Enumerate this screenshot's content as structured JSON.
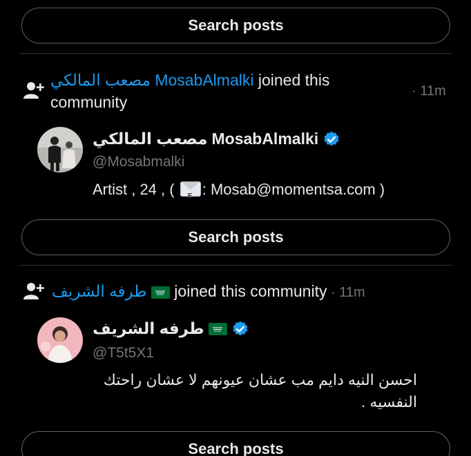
{
  "search_label": "Search posts",
  "events": [
    {
      "user_link_arabic": "مصعب المالكي",
      "user_link_latin": "MosabAlmalki",
      "action": " joined this",
      "action_line2": "community",
      "time": "· 11m",
      "display_name_arabic": "مصعب المالكي",
      "display_name_latin": "MosabAlmalki",
      "handle": "@Mosabmalki",
      "bio_before": "Artist , 24 , (",
      "bio_after": ": Mosab@momentsa.com )"
    },
    {
      "user_link_arabic": "طرفه الشريف",
      "action": " joined this community",
      "time": " · 11m",
      "display_name_arabic": "طرفه الشريف",
      "handle": "@T5t5X1",
      "bio_line1": "احسن النيه دايم مب عشان عيونهم لا عشان راحتك",
      "bio_line2": "النفسيه ."
    }
  ],
  "colors": {
    "background": "#000000",
    "link": "#1d9bf0",
    "verified": "#1d9bf0",
    "secondary_text": "#71767b",
    "border": "#536471"
  },
  "icons": [
    "add-user-icon",
    "verified-badge-icon",
    "saudi-flag-icon",
    "envelope-icon"
  ]
}
